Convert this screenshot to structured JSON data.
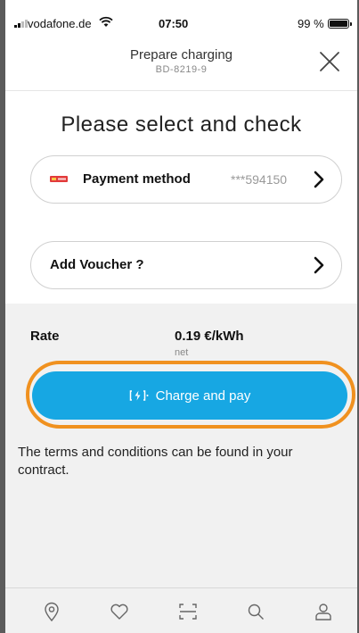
{
  "status_bar": {
    "carrier": "vodafone.de",
    "time": "07:50",
    "battery": "99 %",
    "battery_level": 0.99
  },
  "header": {
    "title": "Prepare charging",
    "subtitle": "BD-8219-9",
    "close_icon": "close-icon"
  },
  "heading": "Please select and check",
  "payment": {
    "label": "Payment method",
    "value": "***594150",
    "icon": "card-icon"
  },
  "voucher": {
    "label": "Add Voucher ?"
  },
  "rate": {
    "label": "Rate",
    "value": "0.19 €/kWh",
    "note": "net"
  },
  "charge_button": {
    "label": "Charge and pay",
    "icon": "charging-icon",
    "highlight_color": "#f0911f",
    "color": "#17a7e3"
  },
  "terms_text": "The terms and conditions can be found in your contract.",
  "bottom_nav": [
    "map-pin-icon",
    "heart-icon",
    "scan-icon",
    "search-icon",
    "profile-icon"
  ]
}
